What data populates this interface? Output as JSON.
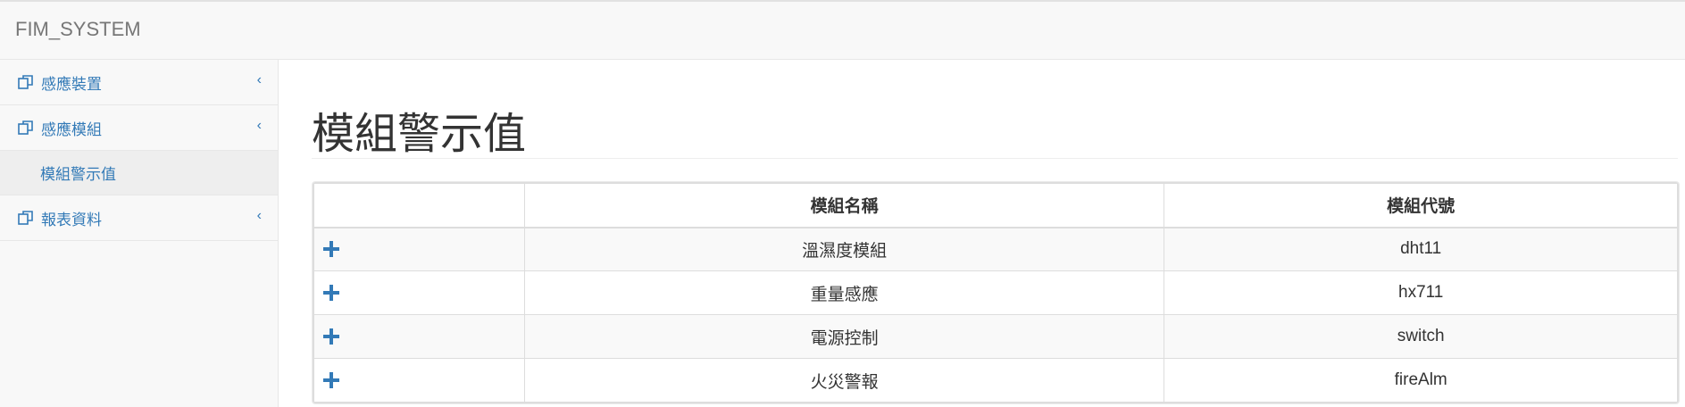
{
  "navbar": {
    "brand": "FIM_SYSTEM"
  },
  "sidebar": {
    "items": [
      {
        "label": "感應裝置",
        "chevron": "‹"
      },
      {
        "label": "感應模組",
        "chevron": "‹",
        "subitems": [
          {
            "label": "模組警示值"
          }
        ]
      },
      {
        "label": "報表資料",
        "chevron": "‹"
      }
    ]
  },
  "main": {
    "title": "模組警示值",
    "table": {
      "headers": [
        "",
        "模組名稱",
        "模組代號"
      ],
      "rows": [
        {
          "name": "溫濕度模組",
          "code": "dht11"
        },
        {
          "name": "重量感應",
          "code": "hx711"
        },
        {
          "name": "電源控制",
          "code": "switch"
        },
        {
          "name": "火災警報",
          "code": "fireAlm"
        }
      ]
    }
  },
  "colors": {
    "link": "#337ab7",
    "navbar_bg": "#f8f8f8"
  },
  "icons": {
    "nav": "copy-icon",
    "expand": "plus-icon"
  }
}
